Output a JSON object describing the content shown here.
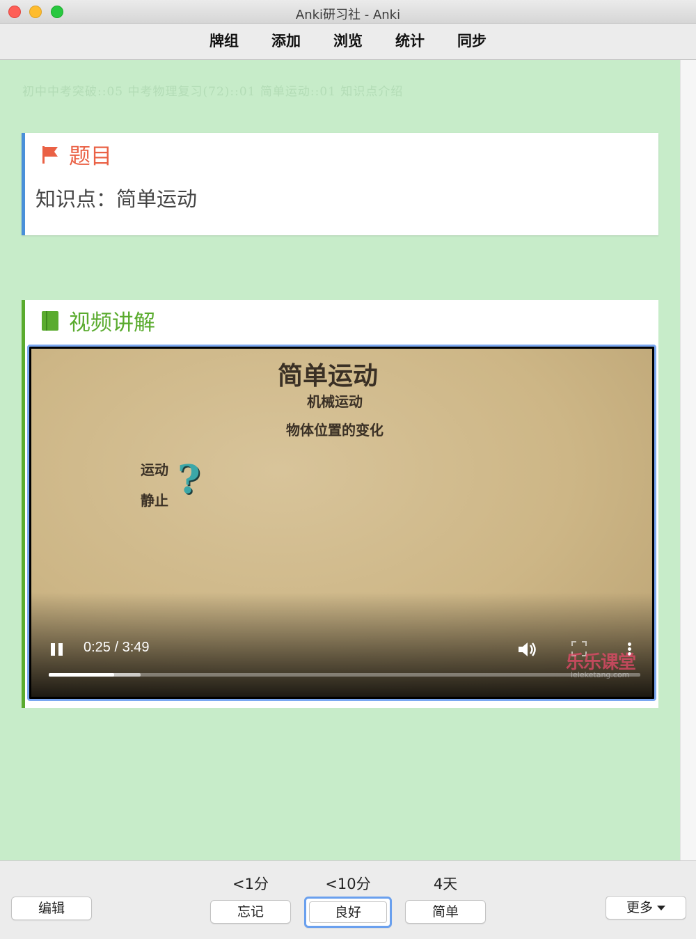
{
  "window": {
    "title": "Anki研习社 - Anki"
  },
  "toolbar": {
    "items": [
      "牌组",
      "添加",
      "浏览",
      "统计",
      "同步"
    ]
  },
  "breadcrumb": "初中中考突破::05 中考物理复习(72)::01 简单运动::01 知识点介绍",
  "question": {
    "heading": "题目",
    "text": "知识点：简单运动",
    "accent_color": "#ea6145",
    "icon": "flag-icon"
  },
  "video_section": {
    "heading": "视频讲解",
    "accent_color": "#5aab2e",
    "icon": "book-icon",
    "video": {
      "title": "简单运动",
      "line1": "机械运动",
      "line2": "物体位置的变化",
      "side1": "运动",
      "side2": "静止",
      "qmark": "?",
      "time": "0:25 / 3:49",
      "played_fraction": 0.11,
      "buffered_fraction": 0.155,
      "watermark": "乐乐课堂",
      "watermark_url": "leleketang.com"
    }
  },
  "answer_bar": {
    "edit_label": "编辑",
    "more_label": "更多",
    "again": {
      "interval": "<1分",
      "label": "忘记"
    },
    "good": {
      "interval": "<10分",
      "label": "良好"
    },
    "easy": {
      "interval": "4天",
      "label": "简单"
    }
  }
}
